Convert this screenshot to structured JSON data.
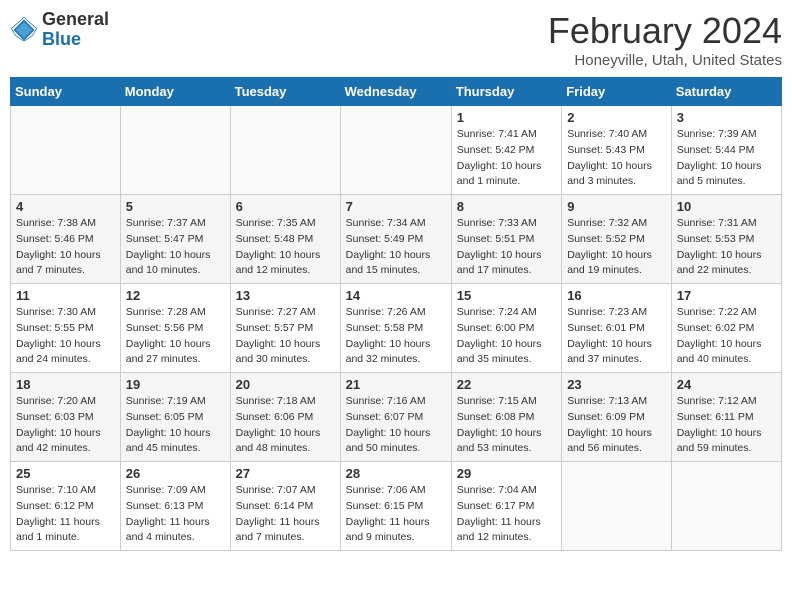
{
  "header": {
    "logo_general": "General",
    "logo_blue": "Blue",
    "title": "February 2024",
    "subtitle": "Honeyville, Utah, United States"
  },
  "days_of_week": [
    "Sunday",
    "Monday",
    "Tuesday",
    "Wednesday",
    "Thursday",
    "Friday",
    "Saturday"
  ],
  "weeks": [
    [
      {
        "day": "",
        "info": ""
      },
      {
        "day": "",
        "info": ""
      },
      {
        "day": "",
        "info": ""
      },
      {
        "day": "",
        "info": ""
      },
      {
        "day": "1",
        "info": "Sunrise: 7:41 AM\nSunset: 5:42 PM\nDaylight: 10 hours and 1 minute."
      },
      {
        "day": "2",
        "info": "Sunrise: 7:40 AM\nSunset: 5:43 PM\nDaylight: 10 hours and 3 minutes."
      },
      {
        "day": "3",
        "info": "Sunrise: 7:39 AM\nSunset: 5:44 PM\nDaylight: 10 hours and 5 minutes."
      }
    ],
    [
      {
        "day": "4",
        "info": "Sunrise: 7:38 AM\nSunset: 5:46 PM\nDaylight: 10 hours and 7 minutes."
      },
      {
        "day": "5",
        "info": "Sunrise: 7:37 AM\nSunset: 5:47 PM\nDaylight: 10 hours and 10 minutes."
      },
      {
        "day": "6",
        "info": "Sunrise: 7:35 AM\nSunset: 5:48 PM\nDaylight: 10 hours and 12 minutes."
      },
      {
        "day": "7",
        "info": "Sunrise: 7:34 AM\nSunset: 5:49 PM\nDaylight: 10 hours and 15 minutes."
      },
      {
        "day": "8",
        "info": "Sunrise: 7:33 AM\nSunset: 5:51 PM\nDaylight: 10 hours and 17 minutes."
      },
      {
        "day": "9",
        "info": "Sunrise: 7:32 AM\nSunset: 5:52 PM\nDaylight: 10 hours and 19 minutes."
      },
      {
        "day": "10",
        "info": "Sunrise: 7:31 AM\nSunset: 5:53 PM\nDaylight: 10 hours and 22 minutes."
      }
    ],
    [
      {
        "day": "11",
        "info": "Sunrise: 7:30 AM\nSunset: 5:55 PM\nDaylight: 10 hours and 24 minutes."
      },
      {
        "day": "12",
        "info": "Sunrise: 7:28 AM\nSunset: 5:56 PM\nDaylight: 10 hours and 27 minutes."
      },
      {
        "day": "13",
        "info": "Sunrise: 7:27 AM\nSunset: 5:57 PM\nDaylight: 10 hours and 30 minutes."
      },
      {
        "day": "14",
        "info": "Sunrise: 7:26 AM\nSunset: 5:58 PM\nDaylight: 10 hours and 32 minutes."
      },
      {
        "day": "15",
        "info": "Sunrise: 7:24 AM\nSunset: 6:00 PM\nDaylight: 10 hours and 35 minutes."
      },
      {
        "day": "16",
        "info": "Sunrise: 7:23 AM\nSunset: 6:01 PM\nDaylight: 10 hours and 37 minutes."
      },
      {
        "day": "17",
        "info": "Sunrise: 7:22 AM\nSunset: 6:02 PM\nDaylight: 10 hours and 40 minutes."
      }
    ],
    [
      {
        "day": "18",
        "info": "Sunrise: 7:20 AM\nSunset: 6:03 PM\nDaylight: 10 hours and 42 minutes."
      },
      {
        "day": "19",
        "info": "Sunrise: 7:19 AM\nSunset: 6:05 PM\nDaylight: 10 hours and 45 minutes."
      },
      {
        "day": "20",
        "info": "Sunrise: 7:18 AM\nSunset: 6:06 PM\nDaylight: 10 hours and 48 minutes."
      },
      {
        "day": "21",
        "info": "Sunrise: 7:16 AM\nSunset: 6:07 PM\nDaylight: 10 hours and 50 minutes."
      },
      {
        "day": "22",
        "info": "Sunrise: 7:15 AM\nSunset: 6:08 PM\nDaylight: 10 hours and 53 minutes."
      },
      {
        "day": "23",
        "info": "Sunrise: 7:13 AM\nSunset: 6:09 PM\nDaylight: 10 hours and 56 minutes."
      },
      {
        "day": "24",
        "info": "Sunrise: 7:12 AM\nSunset: 6:11 PM\nDaylight: 10 hours and 59 minutes."
      }
    ],
    [
      {
        "day": "25",
        "info": "Sunrise: 7:10 AM\nSunset: 6:12 PM\nDaylight: 11 hours and 1 minute."
      },
      {
        "day": "26",
        "info": "Sunrise: 7:09 AM\nSunset: 6:13 PM\nDaylight: 11 hours and 4 minutes."
      },
      {
        "day": "27",
        "info": "Sunrise: 7:07 AM\nSunset: 6:14 PM\nDaylight: 11 hours and 7 minutes."
      },
      {
        "day": "28",
        "info": "Sunrise: 7:06 AM\nSunset: 6:15 PM\nDaylight: 11 hours and 9 minutes."
      },
      {
        "day": "29",
        "info": "Sunrise: 7:04 AM\nSunset: 6:17 PM\nDaylight: 11 hours and 12 minutes."
      },
      {
        "day": "",
        "info": ""
      },
      {
        "day": "",
        "info": ""
      }
    ]
  ]
}
